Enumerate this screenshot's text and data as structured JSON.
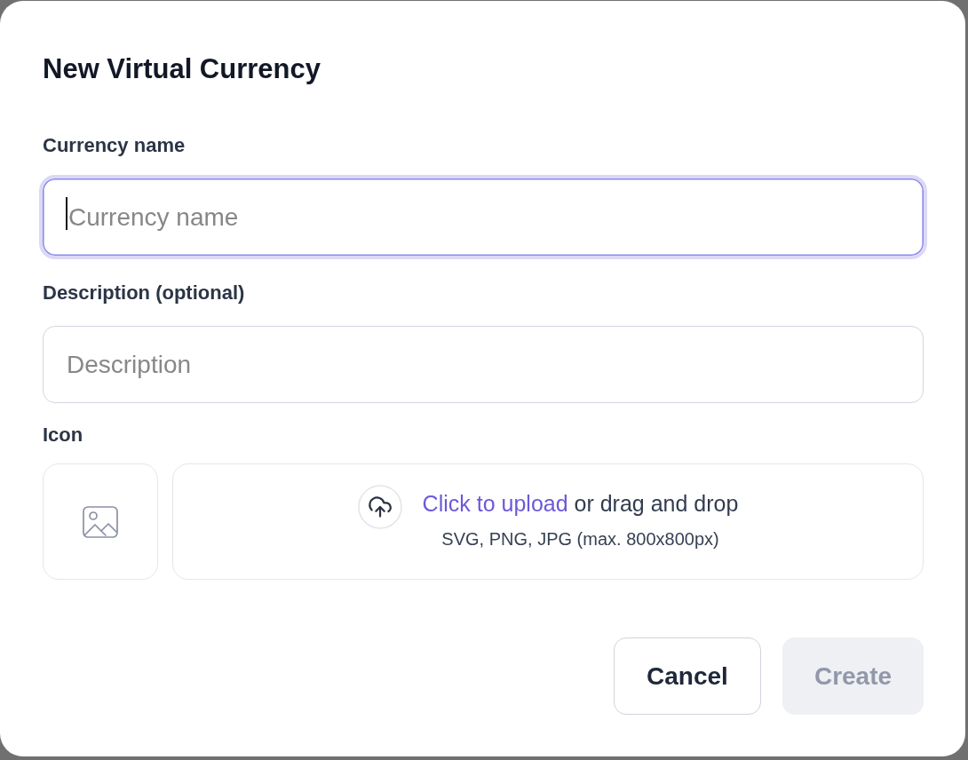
{
  "dialog": {
    "title": "New Virtual Currency"
  },
  "fields": [
    {
      "label": "Currency name",
      "placeholder": "Currency name",
      "focused": true
    },
    {
      "label": "Description (optional)",
      "placeholder": "Description",
      "focused": false
    }
  ],
  "icon_upload": {
    "label": "Icon",
    "link": "Click to upload",
    "prompt": "or drag and drop",
    "hint": "SVG, PNG, JPG (max. 800x800px)"
  },
  "buttons": [
    {
      "label": "Cancel",
      "kind": "secondary",
      "disabled": false
    },
    {
      "label": "Create",
      "kind": "primary",
      "disabled": true
    }
  ]
}
